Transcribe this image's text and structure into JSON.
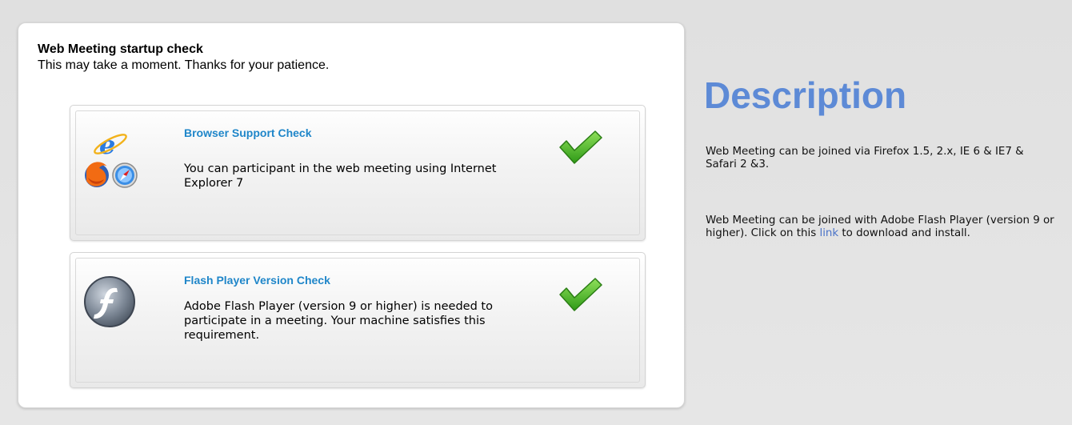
{
  "startup_check": {
    "title": "Web Meeting startup check",
    "subtitle": "This may take a moment.  Thanks for your patience.",
    "checks": [
      {
        "title": "Browser Support Check",
        "message": "You can participant in the web meeting using Internet Explorer 7",
        "icon": "browser-logos-icon",
        "status": "passed",
        "status_icon": "checkmark-icon"
      },
      {
        "title": "Flash Player Version Check",
        "message": "Adobe Flash Player (version 9 or higher) is needed to participate in a meeting. Your machine satisfies this requirement.",
        "icon": "flash-player-icon",
        "status": "passed",
        "status_icon": "checkmark-icon"
      }
    ]
  },
  "description": {
    "heading": "Description",
    "paragraph1": "Web Meeting can be joined via Firefox 1.5, 2.x, IE 6 & IE7 & Safari 2 &3.",
    "paragraph2_before_link": "Web Meeting can be joined with Adobe Flash Player (version 9 or higher). Click on this ",
    "paragraph2_link": "link",
    "paragraph2_after_link": " to download and install."
  },
  "colors": {
    "heading_blue": "#5d8ad6",
    "card_title_blue": "#1f86c9",
    "check_green": "#3fae1f",
    "link_blue": "#4a73c8"
  }
}
